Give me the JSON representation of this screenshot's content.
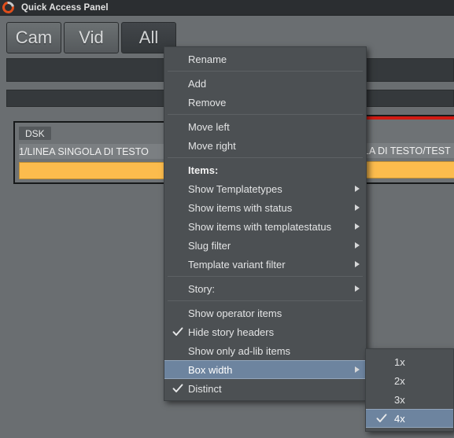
{
  "window": {
    "title": "Quick Access Panel",
    "logo_icon": "circular-arrow-logo",
    "accent_color": "#e04e1b",
    "background_color": "#6a6e71",
    "menu_background_color": "#4c5053",
    "menu_highlight_color": "#6d849f"
  },
  "tabs": [
    {
      "label": "Cam",
      "active": false
    },
    {
      "label": "Vid",
      "active": false
    },
    {
      "label": "All",
      "active": true
    }
  ],
  "content": {
    "left_box": {
      "badge": "DSK",
      "slug": "1/LINEA SINGOLA DI TESTO",
      "bar_color": "#fcbc4d"
    },
    "right_box": {
      "slug": "LA DI TESTO/TEST",
      "top_line_color": "#d11b13",
      "bar_color": "#fcbc4d"
    }
  },
  "context_menu": {
    "groups": [
      {
        "items": [
          {
            "label": "Rename",
            "checked": false,
            "submenu": false,
            "selected": false,
            "header": false
          }
        ]
      },
      {
        "items": [
          {
            "label": "Add",
            "checked": false,
            "submenu": false,
            "selected": false,
            "header": false
          },
          {
            "label": "Remove",
            "checked": false,
            "submenu": false,
            "selected": false,
            "header": false
          }
        ]
      },
      {
        "items": [
          {
            "label": "Move left",
            "checked": false,
            "submenu": false,
            "selected": false,
            "header": false
          },
          {
            "label": "Move right",
            "checked": false,
            "submenu": false,
            "selected": false,
            "header": false
          }
        ]
      },
      {
        "items": [
          {
            "label": "Items:",
            "checked": false,
            "submenu": false,
            "selected": false,
            "header": true
          },
          {
            "label": "Show Templatetypes",
            "checked": false,
            "submenu": true,
            "selected": false,
            "header": false
          },
          {
            "label": "Show items with status",
            "checked": false,
            "submenu": true,
            "selected": false,
            "header": false
          },
          {
            "label": "Show items with templatestatus",
            "checked": false,
            "submenu": true,
            "selected": false,
            "header": false
          },
          {
            "label": "Slug filter",
            "checked": false,
            "submenu": true,
            "selected": false,
            "header": false
          },
          {
            "label": "Template variant filter",
            "checked": false,
            "submenu": true,
            "selected": false,
            "header": false
          }
        ]
      },
      {
        "items": [
          {
            "label": "Story:",
            "checked": false,
            "submenu": true,
            "selected": false,
            "header": false
          }
        ]
      },
      {
        "items": [
          {
            "label": "Show operator items",
            "checked": false,
            "submenu": false,
            "selected": false,
            "header": false
          },
          {
            "label": "Hide story headers",
            "checked": true,
            "submenu": false,
            "selected": false,
            "header": false
          },
          {
            "label": "Show only ad-lib items",
            "checked": false,
            "submenu": false,
            "selected": false,
            "header": false
          },
          {
            "label": "Box width",
            "checked": false,
            "submenu": true,
            "selected": true,
            "header": false
          },
          {
            "label": "Distinct",
            "checked": true,
            "submenu": false,
            "selected": false,
            "header": false
          }
        ]
      }
    ]
  },
  "submenu": {
    "parent": "Box width",
    "items": [
      {
        "label": "1x",
        "checked": false,
        "selected": false
      },
      {
        "label": "2x",
        "checked": false,
        "selected": false
      },
      {
        "label": "3x",
        "checked": false,
        "selected": false
      },
      {
        "label": "4x",
        "checked": true,
        "selected": true
      }
    ]
  }
}
